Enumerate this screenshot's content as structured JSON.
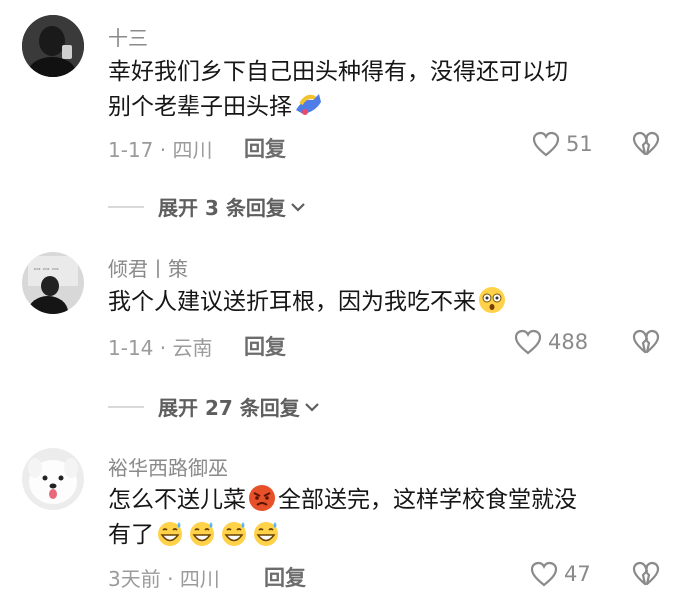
{
  "comments": [
    {
      "username": "十三",
      "text_line1": "幸好我们乡下自己田头种得有，没得还可以切",
      "text_line2": "别个老辈子田头择",
      "date": "1-17",
      "location": "四川",
      "reply_label": "回复",
      "likes": "51",
      "expand_label": "展开 3 条回复"
    },
    {
      "username": "倾君丨策",
      "text_line1": "我个人建议送折耳根，因为我吃不来",
      "date": "1-14",
      "location": "云南",
      "reply_label": "回复",
      "likes": "488",
      "expand_label": "展开 27 条回复"
    },
    {
      "username": "裕华西路御巫",
      "text_line1a": "怎么不送儿菜",
      "text_line1b": "全部送完，这样学校食堂就没",
      "text_line2": "有了",
      "date": "3天前",
      "location": "四川",
      "reply_label": "回复",
      "likes": "47"
    }
  ],
  "icons": [
    "heart-outline-icon",
    "broken-heart-icon",
    "chevron-down-icon"
  ],
  "colors": {
    "meta": "#9b9b9b",
    "text": "#161616"
  }
}
